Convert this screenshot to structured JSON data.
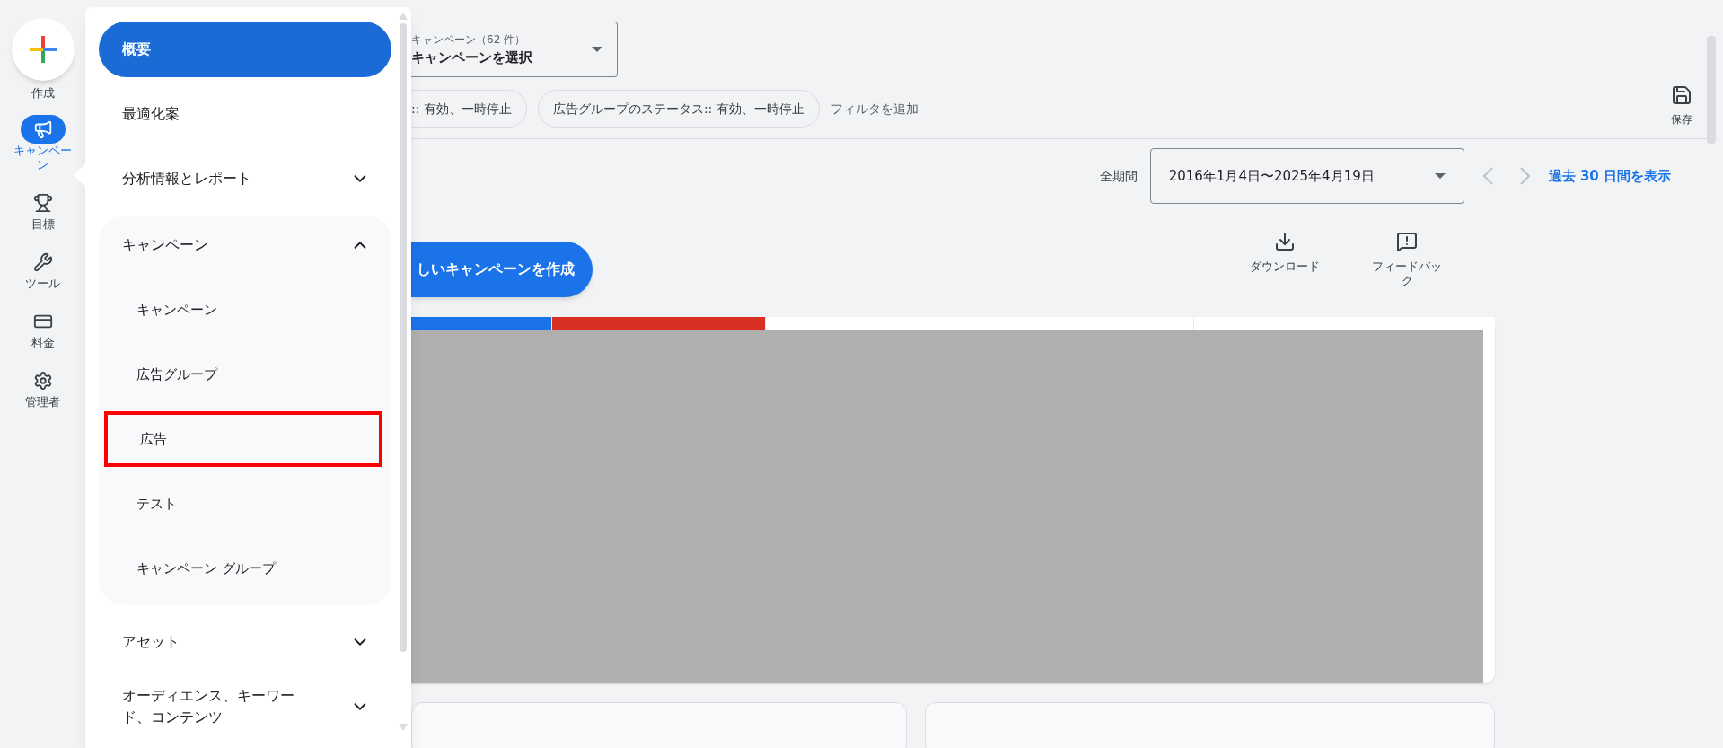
{
  "rail": {
    "create": {
      "label": "作成"
    },
    "items": [
      {
        "label": "キャンペーン",
        "selected": true
      },
      {
        "label": "目標",
        "selected": false
      },
      {
        "label": "ツール",
        "selected": false
      },
      {
        "label": "料金",
        "selected": false
      },
      {
        "label": "管理者",
        "selected": false
      }
    ]
  },
  "menu": {
    "items": [
      {
        "label": "概要",
        "selected": true
      },
      {
        "label": "最適化案",
        "selected": false
      },
      {
        "label": "分析情報とレポート",
        "selected": false,
        "expanded": false
      },
      {
        "label": "キャンペーン",
        "selected": false,
        "expanded": true,
        "children": [
          {
            "label": "キャンペーン",
            "outlined": false
          },
          {
            "label": "広告グループ",
            "outlined": false
          },
          {
            "label": "広告",
            "outlined": true
          },
          {
            "label": "テスト",
            "outlined": false
          },
          {
            "label": "キャンペーン グループ",
            "outlined": false
          }
        ]
      },
      {
        "label": "アセット",
        "selected": false,
        "expanded": false
      },
      {
        "label": "オーディエンス、キーワード、コンテンツ",
        "selected": false,
        "expanded": false
      }
    ]
  },
  "campaign_selector": {
    "label": "キャンペーン（62 件）",
    "value": "キャンペーンを選択"
  },
  "filters": [
    ":: 有効、一時停止",
    "広告グループのステータス:: 有効、一時停止"
  ],
  "add_filter": "フィルタを追加",
  "save": "保存",
  "date_range": {
    "label": "全期間",
    "value": "2016年1月4日〜2025年4月19日",
    "link": "過去 30 日間を表示"
  },
  "create_button": "しいキャンペーンを作成",
  "actions": [
    "ダウンロード",
    "フィードバック"
  ],
  "metric_tabs": [
    {
      "color": "#1a73e8"
    },
    {
      "color": "#d93025"
    },
    {
      "color": "#ffffff"
    },
    {
      "color": "#ffffff"
    },
    {
      "color": "#ffffff"
    }
  ]
}
